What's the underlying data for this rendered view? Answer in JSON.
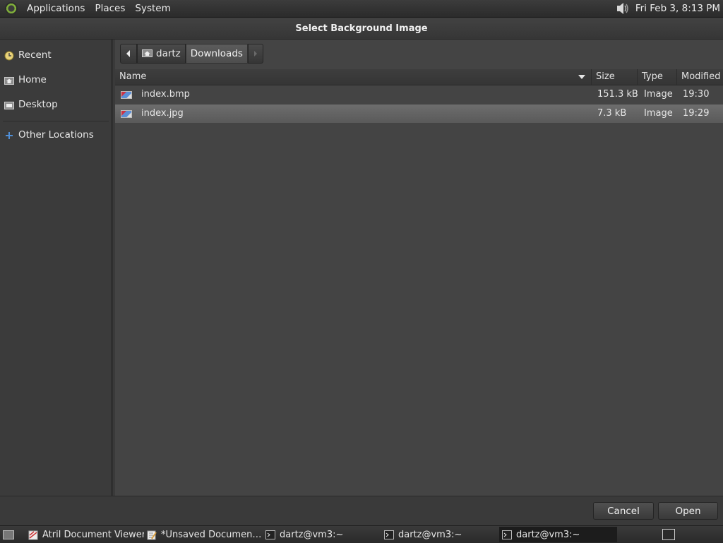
{
  "top_panel": {
    "menus": [
      "Applications",
      "Places",
      "System"
    ],
    "clock": "Fri Feb  3,  8:13 PM"
  },
  "dialog": {
    "title": "Select Background Image",
    "sidebar": {
      "items": [
        {
          "label": "Recent",
          "icon": "recent-icon"
        },
        {
          "label": "Home",
          "icon": "home-icon"
        },
        {
          "label": "Desktop",
          "icon": "desktop-icon"
        },
        {
          "label": "Other Locations",
          "icon": "plus-icon"
        }
      ]
    },
    "pathbar": {
      "segments": [
        "dartz",
        "Downloads"
      ]
    },
    "columns": {
      "name": "Name",
      "size": "Size",
      "type": "Type",
      "modified": "Modified"
    },
    "files": [
      {
        "name": "index.bmp",
        "size": "151.3 kB",
        "type": "Image",
        "modified": "19:30",
        "selected": false
      },
      {
        "name": "index.jpg",
        "size": "7.3 kB",
        "type": "Image",
        "modified": "19:29",
        "selected": true
      }
    ],
    "buttons": {
      "cancel": "Cancel",
      "open": "Open"
    }
  },
  "taskbar": {
    "tasks": [
      {
        "label": "Atril Document Viewer",
        "icon": "atril-icon",
        "active": false
      },
      {
        "label": "*Unsaved Documen…",
        "icon": "text-editor-icon",
        "active": false
      },
      {
        "label": "dartz@vm3:~",
        "icon": "terminal-icon",
        "active": false
      },
      {
        "label": "dartz@vm3:~",
        "icon": "terminal-icon",
        "active": false
      },
      {
        "label": "dartz@vm3:~",
        "icon": "terminal-icon",
        "active": true
      }
    ]
  }
}
